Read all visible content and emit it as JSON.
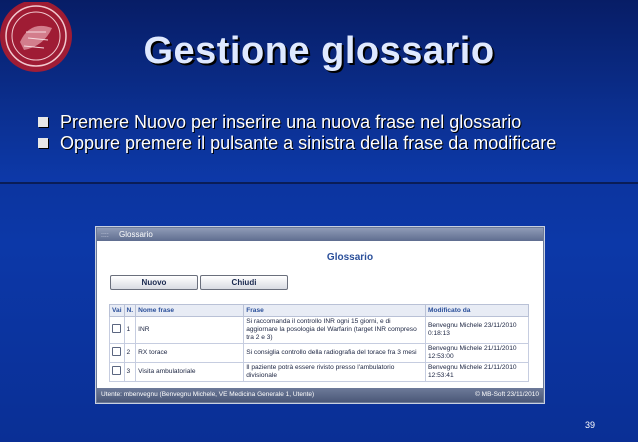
{
  "slide": {
    "title": "Gestione glossario",
    "bullets": [
      "Premere Nuovo per inserire una nuova frase nel glossario",
      "Oppure premere il pulsante a sinistra della frase da modificare"
    ],
    "page_number": "39"
  },
  "window": {
    "title": "Glossario",
    "heading": "Glossario",
    "buttons": {
      "new_label": "Nuovo",
      "close_label": "Chiudi"
    },
    "table": {
      "headers": [
        "Vai",
        "N.",
        "Nome frase",
        "Frase",
        "Modificato da"
      ],
      "rows": [
        {
          "n": "1",
          "name": "INR",
          "phrase": "Si raccomanda il controllo INR ogni 15 giorni, e di aggiornare la posologia del Warfarin (target INR compreso tra 2 e 3)",
          "modified_by": "Benvegnu Michele 23/11/2010 0:18:13"
        },
        {
          "n": "2",
          "name": "RX torace",
          "phrase": "Si consiglia controllo della radiografia del torace fra 3 mesi",
          "modified_by": "Benvegnu Michele 21/11/2010 12:53:00"
        },
        {
          "n": "3",
          "name": "Visita ambulatoriale",
          "phrase": "Il paziente potrà essere rivisto presso l'ambulatorio divisionale",
          "modified_by": "Benvegnu Michele 21/11/2010 12:53:41"
        }
      ]
    },
    "status": {
      "user": "Utente: mbenvegnu (Benvegnu Michele, VE Medicina Generale 1, Utente)",
      "copyright": "© MB-Soft 23/11/2010"
    }
  },
  "colors": {
    "slide_blue": "#0b2f93",
    "heading_blue": "#2a4f9a"
  }
}
